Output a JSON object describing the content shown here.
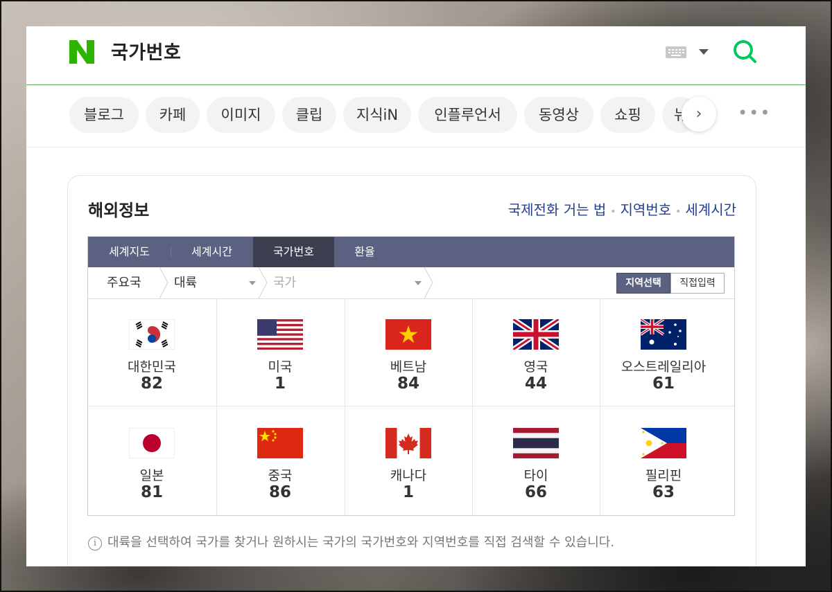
{
  "header": {
    "query": "국가번호",
    "brand_color": "#03c75a",
    "icons": [
      "naver-logo-icon",
      "keyboard-icon",
      "chevron-down-icon",
      "search-icon"
    ]
  },
  "tabs": {
    "items": [
      "블로그",
      "카페",
      "이미지",
      "클립",
      "지식iN",
      "인플루언서",
      "동영상",
      "쇼핑",
      "뉴"
    ],
    "next_icon": "chevron-right-icon",
    "more_icon": "more-dots-icon"
  },
  "panel": {
    "title": "해외정보",
    "links": [
      "국제전화 거는 법",
      "지역번호",
      "세계시간"
    ],
    "nav_tabs": [
      "세계지도",
      "세계시간",
      "국가번호",
      "환율"
    ],
    "active_tab": "국가번호",
    "filter": {
      "crumb": "주요국",
      "continent": "대륙",
      "country_placeholder": "국가",
      "mode_on": "지역선택",
      "mode_off": "직접입력"
    },
    "countries": [
      {
        "name": "대한민국",
        "code": "82",
        "flag": "korea-flag-icon"
      },
      {
        "name": "미국",
        "code": "1",
        "flag": "usa-flag-icon"
      },
      {
        "name": "베트남",
        "code": "84",
        "flag": "vietnam-flag-icon"
      },
      {
        "name": "영국",
        "code": "44",
        "flag": "uk-flag-icon"
      },
      {
        "name": "오스트레일리아",
        "code": "61",
        "flag": "australia-flag-icon"
      },
      {
        "name": "일본",
        "code": "81",
        "flag": "japan-flag-icon"
      },
      {
        "name": "중국",
        "code": "86",
        "flag": "china-flag-icon"
      },
      {
        "name": "캐나다",
        "code": "1",
        "flag": "canada-flag-icon"
      },
      {
        "name": "타이",
        "code": "66",
        "flag": "thailand-flag-icon"
      },
      {
        "name": "필리핀",
        "code": "63",
        "flag": "philippines-flag-icon"
      }
    ],
    "note": "대륙을 선택하여 국가를 찾거나 원하시는 국가의 국가번호와 지역번호를 직접 검색할 수 있습니다."
  }
}
